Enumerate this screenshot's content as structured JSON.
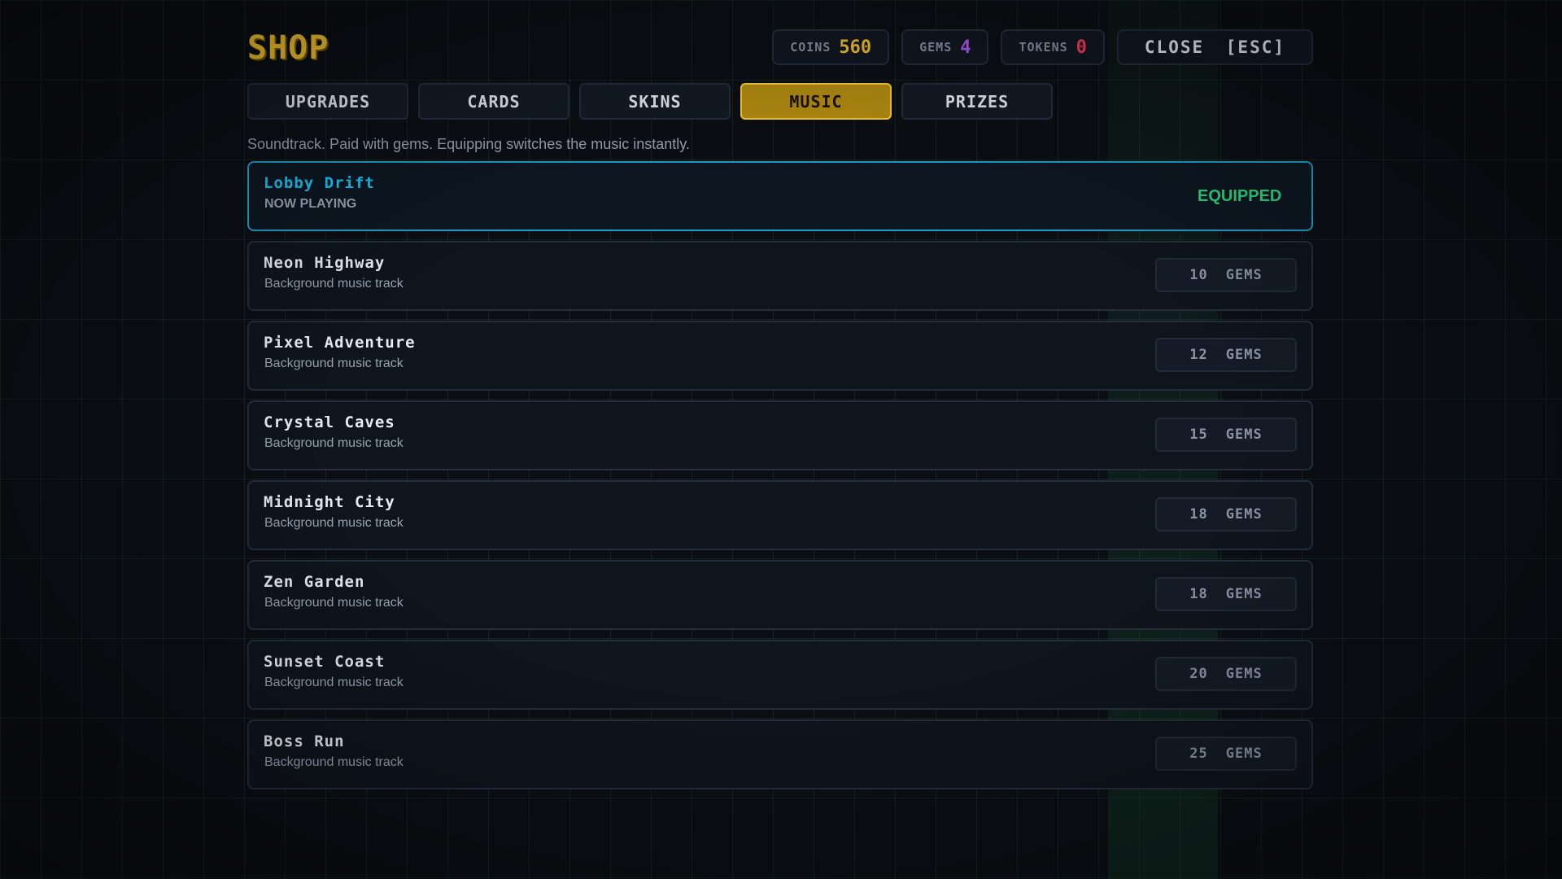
{
  "title": "SHOP",
  "stats": [
    {
      "label": "COINS",
      "value": "560",
      "color": "#f4c430"
    },
    {
      "label": "GEMS",
      "value": "4",
      "color": "#b25cf5"
    },
    {
      "label": "TOKENS",
      "value": "0",
      "color": "#ff3b5c"
    }
  ],
  "close_label": "CLOSE [ESC]",
  "tabs": [
    {
      "label": "UPGRADES",
      "active": false
    },
    {
      "label": "CARDS",
      "active": false
    },
    {
      "label": "SKINS",
      "active": false
    },
    {
      "label": "MUSIC",
      "active": true
    },
    {
      "label": "PRIZES",
      "active": false
    }
  ],
  "hint": "Soundtrack. Paid with gems. Equipping switches the music instantly.",
  "tracks": [
    {
      "name": "Lobby Drift",
      "subtitle": "NOW PLAYING",
      "equipped": true,
      "status": "EQUIPPED"
    },
    {
      "name": "Neon Highway",
      "subtitle": "Background music track",
      "price": "10",
      "currency": "GEMS"
    },
    {
      "name": "Pixel Adventure",
      "subtitle": "Background music track",
      "price": "12",
      "currency": "GEMS"
    },
    {
      "name": "Crystal Caves",
      "subtitle": "Background music track",
      "price": "15",
      "currency": "GEMS"
    },
    {
      "name": "Midnight City",
      "subtitle": "Background music track",
      "price": "18",
      "currency": "GEMS"
    },
    {
      "name": "Zen Garden",
      "subtitle": "Background music track",
      "price": "18",
      "currency": "GEMS"
    },
    {
      "name": "Sunset Coast",
      "subtitle": "Background music track",
      "price": "20",
      "currency": "GEMS"
    },
    {
      "name": "Boss Run",
      "subtitle": "Background music track",
      "price": "25",
      "currency": "GEMS"
    }
  ]
}
